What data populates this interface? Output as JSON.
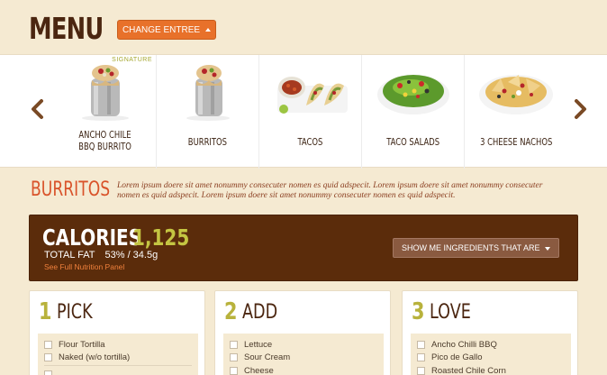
{
  "header": {
    "title": "MENU",
    "change_button": "CHANGE ENTREE"
  },
  "carousel": {
    "items": [
      {
        "label": "ANCHO CHILE\nBBQ BURRITO",
        "badge": "SIGNATURE",
        "icon": "burrito-icon"
      },
      {
        "label": "BURRITOS",
        "icon": "burrito-icon"
      },
      {
        "label": "TACOS",
        "icon": "tacos-icon"
      },
      {
        "label": "TACO SALADS",
        "icon": "salad-icon"
      },
      {
        "label": "3 CHEESE NACHOS",
        "icon": "nachos-icon"
      }
    ]
  },
  "section": {
    "title": "BURRITOS",
    "description": "Lorem ipsum doere sit amet nonummy consecuter nomen es quid adspecit. Lorem ipsum doere sit amet nonummy consecuter nomen es quid adspecit. Lorem ipsum doere sit amet nonummy consecuter nomen es quid adspecit."
  },
  "nutrition": {
    "calories_label": "CALORIES",
    "calories_value": "1,125",
    "fat_label": "TOTAL FAT",
    "fat_value": "53% / 34.5g",
    "panel_link": "See Full Nutrition Panel",
    "ingredients_button": "SHOW ME INGREDIENTS THAT ARE"
  },
  "steps": [
    {
      "number": "1",
      "title": "PICK",
      "options": [
        "Flour Tortilla",
        "Naked (w/o tortilla)"
      ]
    },
    {
      "number": "2",
      "title": "ADD",
      "options": [
        "Lettuce",
        "Sour Cream",
        "Cheese"
      ]
    },
    {
      "number": "3",
      "title": "LOVE",
      "options": [
        "Ancho Chilli BBQ",
        "Pico de Gallo",
        "Roasted Chile Corn"
      ]
    }
  ]
}
